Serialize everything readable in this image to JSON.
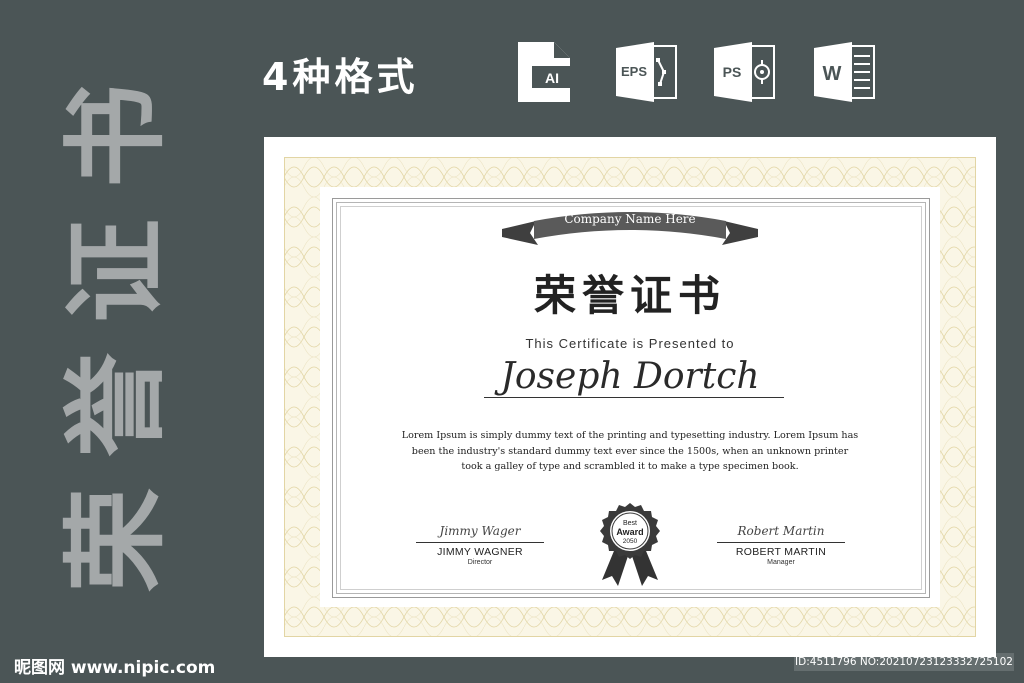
{
  "side_title": [
    "荣",
    "誉",
    "证",
    "书"
  ],
  "formats": {
    "label": "4种格式",
    "icons": [
      {
        "name": "ai-file-icon",
        "text": "AI"
      },
      {
        "name": "eps-file-icon",
        "text": "EPS"
      },
      {
        "name": "ps-file-icon",
        "text": "PS"
      },
      {
        "name": "word-file-icon",
        "text": "W"
      }
    ]
  },
  "certificate": {
    "company": "Company Name Here",
    "title": "荣誉证书",
    "presented_to": "This Certificate is Presented to",
    "recipient": "Joseph Dortch",
    "body": "Lorem Ipsum is simply dummy text of the printing and typesetting industry. Lorem Ipsum has been the industry's standard dummy text ever since the 1500s, when an unknown printer took a galley of type and scrambled it to make a type specimen book.",
    "signatures": [
      {
        "script": "Jimmy Wager",
        "name": "JIMMY WAGNER",
        "role": "Director"
      },
      {
        "script": "Robert Martin",
        "name": "ROBERT MARTIN",
        "role": "Manager"
      }
    ],
    "badge": {
      "line1": "Best",
      "line2": "Award",
      "line3": "2050"
    }
  },
  "watermark": {
    "left": "昵图网 www.nipic.com",
    "right": "ID:4511796 NO:20210723123332725102"
  },
  "colors": {
    "background": "#4b5556",
    "side_text": "#a4a8a9",
    "guilloche": "#e8dcb0",
    "ribbon": "#3f3f3f"
  }
}
